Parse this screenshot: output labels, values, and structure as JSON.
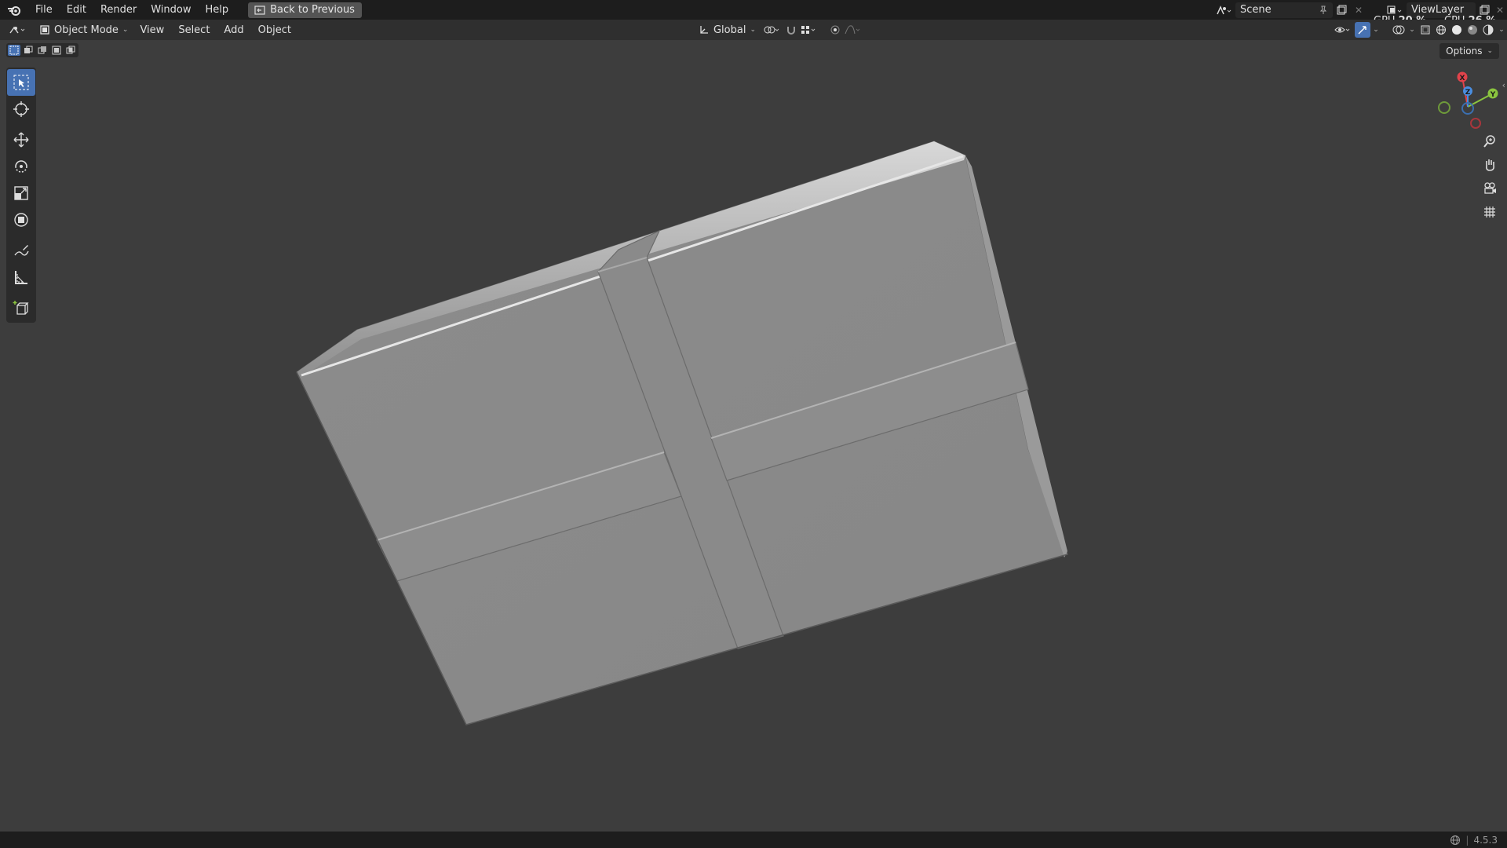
{
  "topbar": {
    "menus": [
      "File",
      "Edit",
      "Render",
      "Window",
      "Help"
    ],
    "back_button": "Back to Previous",
    "scene": "Scene",
    "view_layer": "ViewLayer"
  },
  "perf": {
    "gpu_label": "GPU",
    "gpu_value": "20 %",
    "cpu_label": "CPU",
    "cpu_value": "26 %"
  },
  "header": {
    "mode": "Object Mode",
    "menus": [
      "View",
      "Select",
      "Add",
      "Object"
    ],
    "transform_orientation": "Global"
  },
  "viewport": {
    "options_label": "Options",
    "gizmo": {
      "x": "X",
      "y": "Y",
      "z": "Z"
    }
  },
  "status": {
    "version": "4.5.3"
  },
  "colors": {
    "accent": "#4772b3",
    "axis_x": "#e2434b",
    "axis_y": "#8bc53f",
    "axis_z": "#4a8ee0"
  }
}
